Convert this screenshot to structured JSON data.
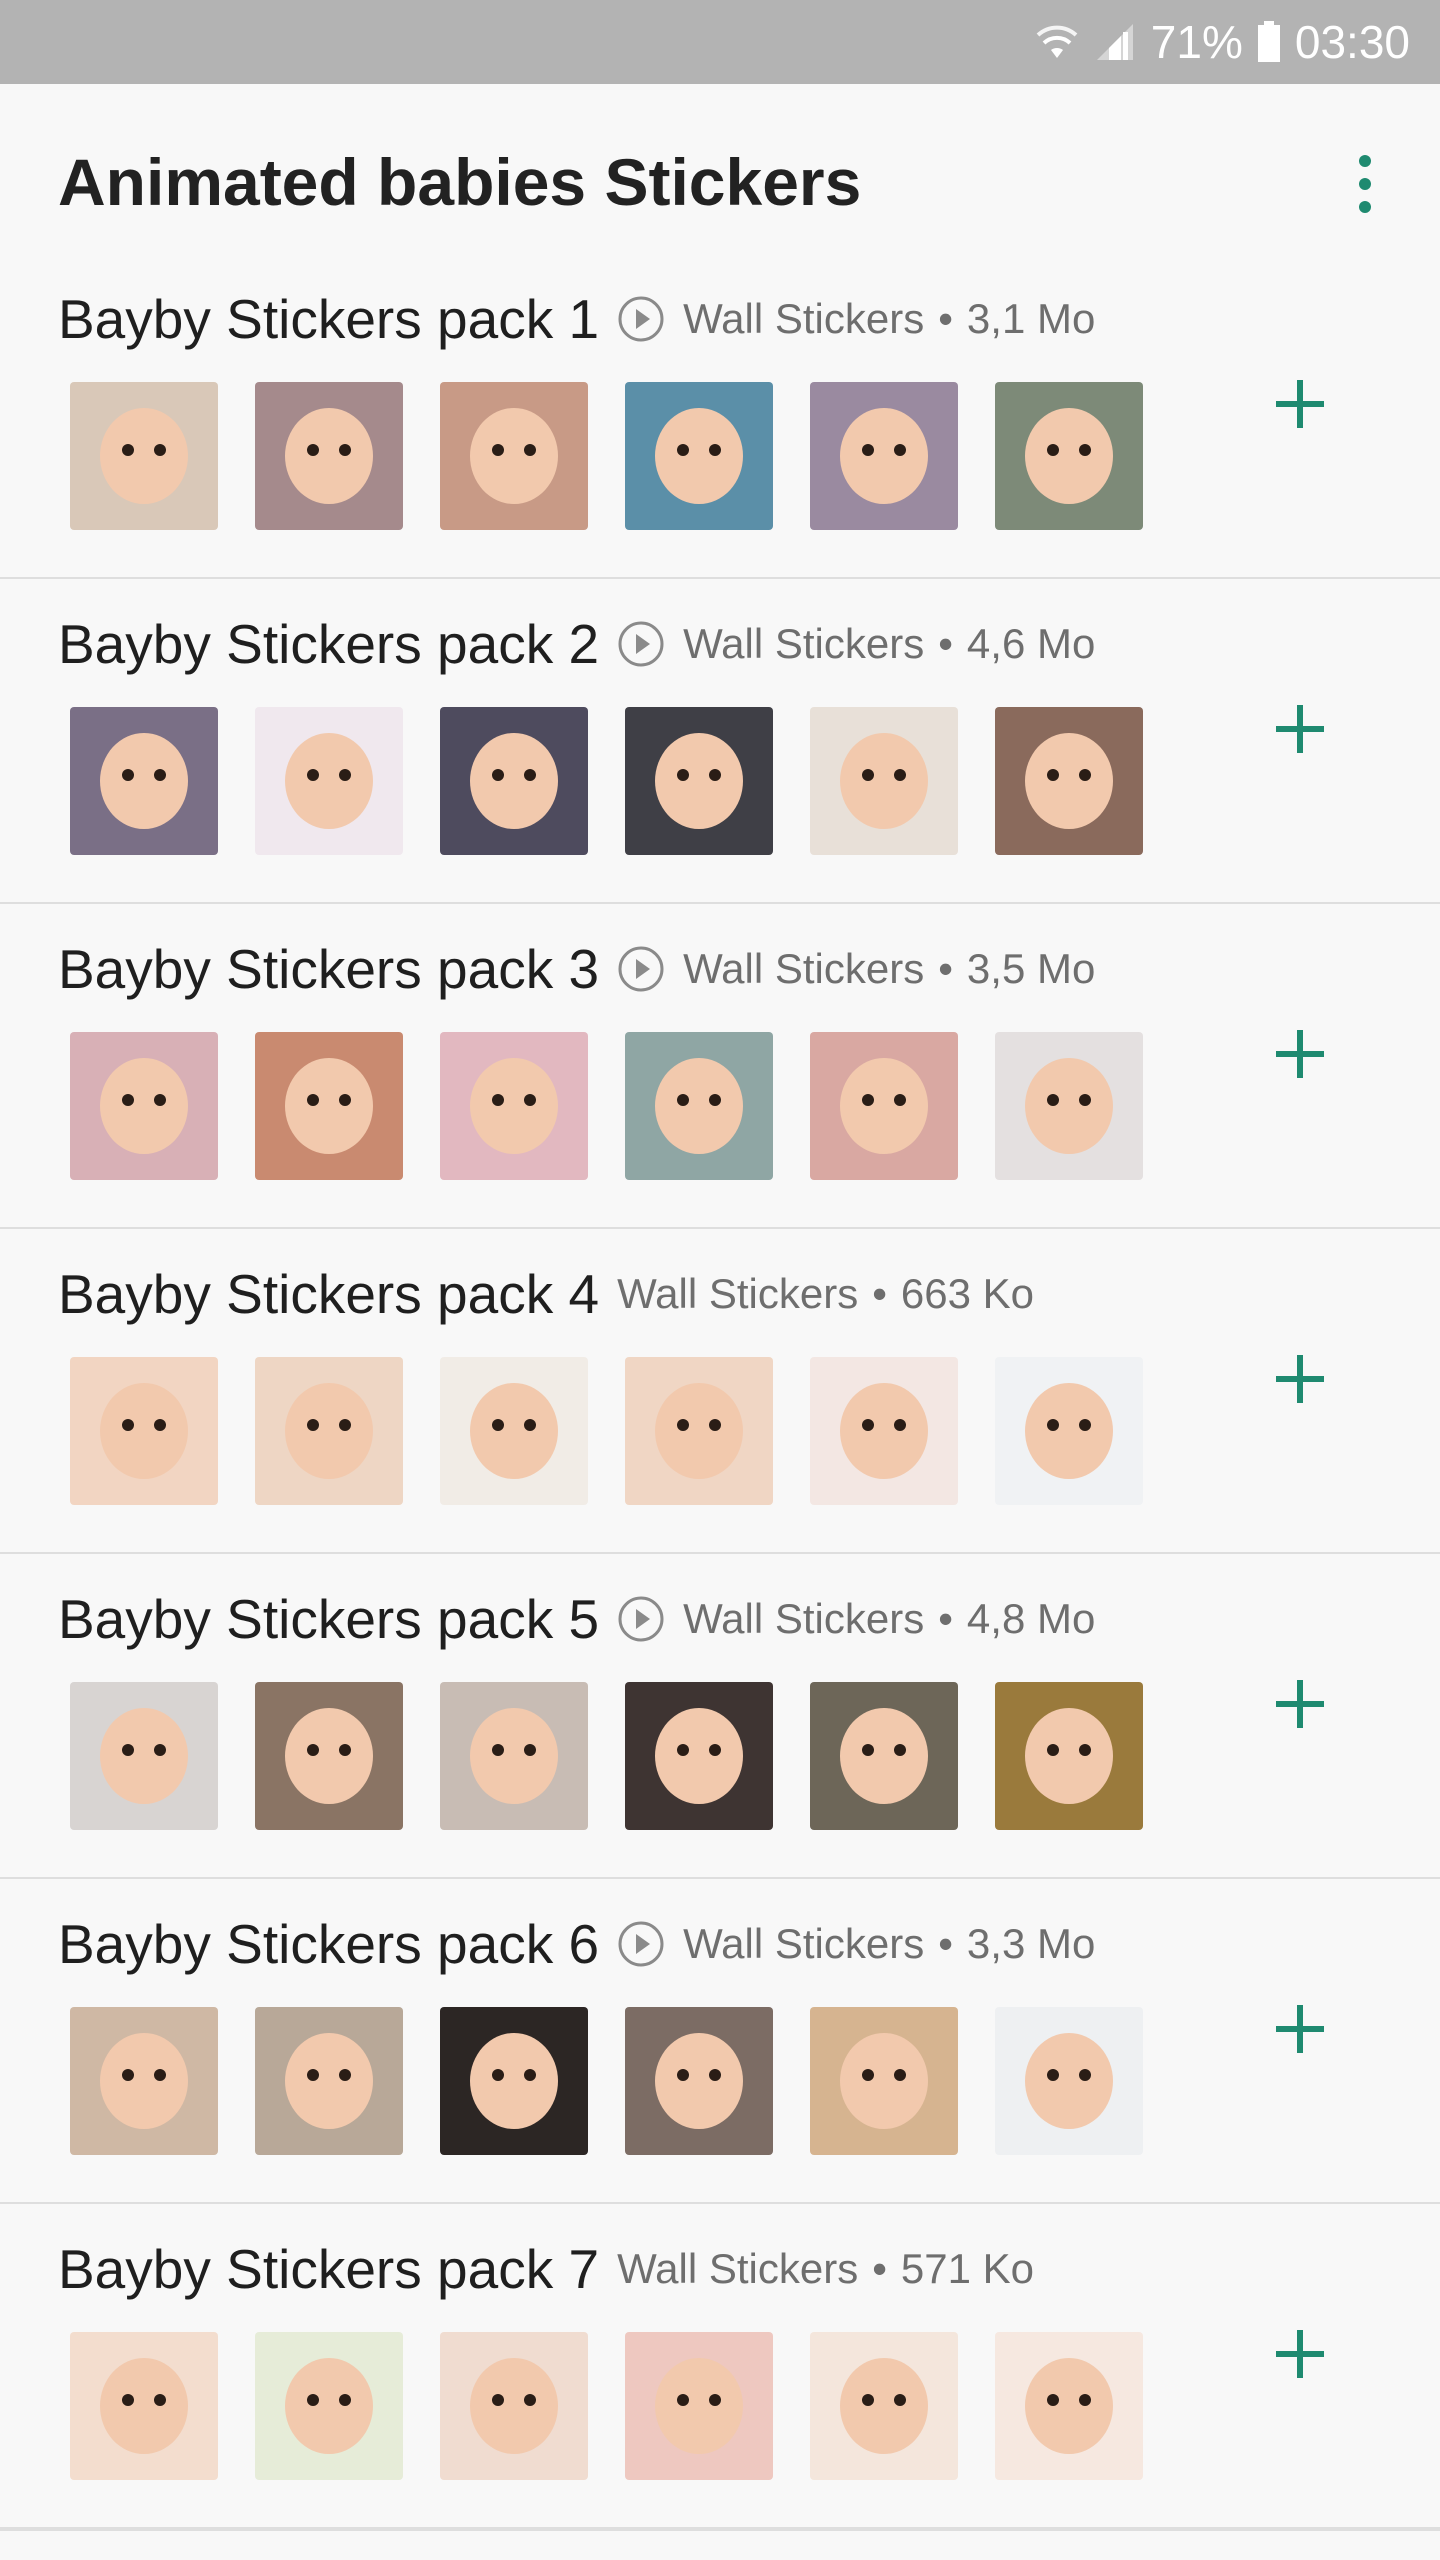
{
  "status_bar": {
    "battery": "71%",
    "time": "03:30",
    "icons": [
      "wifi-icon",
      "signal-icon",
      "battery-icon"
    ]
  },
  "app": {
    "title": "Animated babies Stickers",
    "menu_icon": "more-vert-icon",
    "accent_color": "#1f8a70"
  },
  "packs": [
    {
      "name": "Bayby Stickers pack 1",
      "animated": true,
      "publisher": "Wall Stickers",
      "separator": "•",
      "size": "3,1 Mo",
      "stickers": [
        "#d9c8b8",
        "#a58a8c",
        "#c89a86",
        "#5b8fa8",
        "#9a8aa0",
        "#7d8a78"
      ]
    },
    {
      "name": "Bayby Stickers pack 2",
      "animated": true,
      "publisher": "Wall Stickers",
      "separator": "•",
      "size": "4,6 Mo",
      "stickers": [
        "#7a6f86",
        "#f0e8ee",
        "#4e4b5e",
        "#3f3f46",
        "#e8e0d8",
        "#8a6a5c"
      ]
    },
    {
      "name": "Bayby Stickers pack 3",
      "animated": true,
      "publisher": "Wall Stickers",
      "separator": "•",
      "size": "3,5 Mo",
      "stickers": [
        "#d8b0b6",
        "#c98a70",
        "#e2b8c0",
        "#8fa6a4",
        "#d9a8a2",
        "#e4e0e0"
      ]
    },
    {
      "name": "Bayby Stickers pack 4",
      "animated": false,
      "publisher": "Wall Stickers",
      "separator": "•",
      "size": "663 Ko",
      "stickers": [
        "#f2d5c2",
        "#eed6c4",
        "#f1ece6",
        "#f0d6c4",
        "#f3e7e3",
        "#f0f2f4"
      ]
    },
    {
      "name": "Bayby Stickers pack 5",
      "animated": true,
      "publisher": "Wall Stickers",
      "separator": "•",
      "size": "4,8 Mo",
      "stickers": [
        "#d8d4d2",
        "#8a7464",
        "#c8bcb4",
        "#3e3432",
        "#6d6658",
        "#9a7a3c"
      ]
    },
    {
      "name": "Bayby Stickers pack 6",
      "animated": true,
      "publisher": "Wall Stickers",
      "separator": "•",
      "size": "3,3 Mo",
      "stickers": [
        "#cfb8a4",
        "#b8a898",
        "#2c2624",
        "#7c6c64",
        "#d6b490",
        "#eef0f2"
      ]
    },
    {
      "name": "Bayby Stickers pack 7",
      "animated": false,
      "publisher": "Wall Stickers",
      "separator": "•",
      "size": "571 Ko",
      "stickers": [
        "#f3ddce",
        "#e6ecd8",
        "#f0dcd0",
        "#eec8c0",
        "#f4e6dc",
        "#f6e8e0"
      ]
    }
  ]
}
